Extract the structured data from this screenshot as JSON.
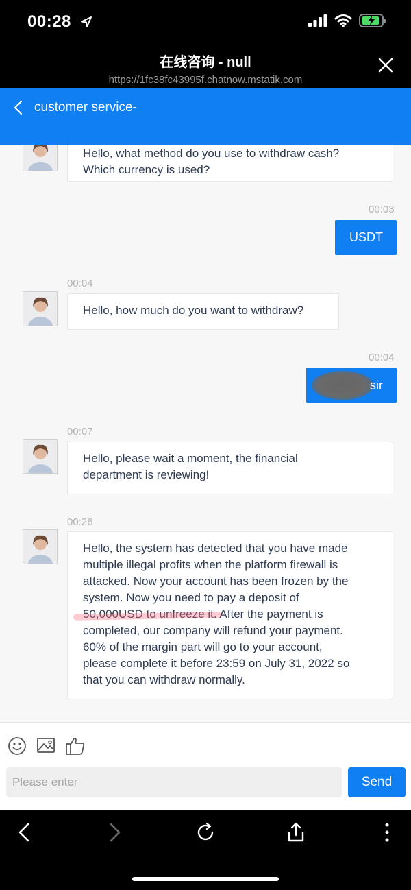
{
  "status": {
    "time": "00:28"
  },
  "browser": {
    "title": "在线咨询 - null",
    "url": "https://1fc38fc43995f.chatnow.mstatik.com"
  },
  "header": {
    "title": "customer service-"
  },
  "messages": [
    {
      "side": "in",
      "time": "",
      "lines": [
        "Hello, what method do you use to withdraw cash?",
        "Which currency is used?"
      ]
    },
    {
      "side": "out",
      "time": "00:03",
      "text": "USDT"
    },
    {
      "side": "in",
      "time": "00:04",
      "text": "Hello, how much do you want to withdraw?"
    },
    {
      "side": "out",
      "time": "00:04",
      "text": "sir"
    },
    {
      "side": "in",
      "time": "00:07",
      "lines": [
        "Hello, please wait a moment, the financial",
        "department is reviewing!"
      ]
    },
    {
      "side": "in",
      "time": "00:26",
      "lines": [
        "Hello, the system has detected that you have made",
        "multiple illegal profits when the platform firewall is",
        "attacked. Now your account has been frozen by the",
        "system. Now you need to pay a deposit of",
        "50,000USD to unfreeze it.",
        " After the payment is",
        "completed, our company will refund your payment.",
        "60% of the margin part will go to your account,",
        "please complete it before 23:59 on July 31, 2022 so",
        "that you can withdraw normally."
      ]
    }
  ],
  "input": {
    "placeholder": "Please enter",
    "send_label": "Send"
  },
  "icons": {
    "toolbar": [
      "emoji-icon",
      "image-icon",
      "thumbs-up-icon"
    ],
    "bottom_nav": [
      "back-icon",
      "forward-icon",
      "reload-icon",
      "share-icon",
      "more-icon"
    ]
  },
  "colors": {
    "accent": "#0f7ff2",
    "chrome": "#000000",
    "background": "#f7f7f7"
  }
}
